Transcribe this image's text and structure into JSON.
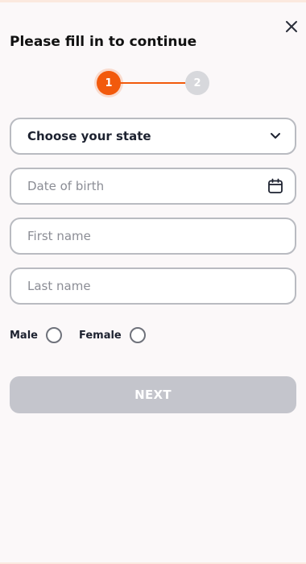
{
  "header": {
    "title": "Please fill in to continue"
  },
  "stepper": {
    "steps": [
      {
        "label": "1",
        "state": "active"
      },
      {
        "label": "2",
        "state": "inactive"
      }
    ],
    "active_color": "#f25a0c",
    "inactive_color": "#d7d8dc"
  },
  "form": {
    "state_select": {
      "label": "Choose your state"
    },
    "date_of_birth": {
      "placeholder": "Date of birth"
    },
    "first_name": {
      "placeholder": "First name"
    },
    "last_name": {
      "placeholder": "Last name"
    },
    "gender": {
      "options": [
        {
          "label": "Male",
          "selected": false
        },
        {
          "label": "Female",
          "selected": false
        }
      ]
    }
  },
  "actions": {
    "next_label": "NEXT",
    "next_enabled": false
  },
  "icons": {
    "close": "close-icon",
    "dropdown": "chevron-down-icon",
    "calendar": "calendar-icon"
  }
}
